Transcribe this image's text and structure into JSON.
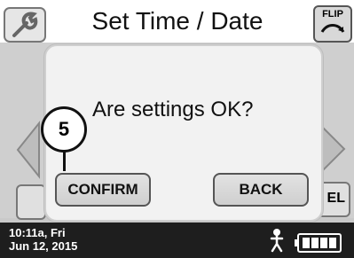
{
  "header": {
    "title": "Set Time / Date",
    "flip_label": "FLIP",
    "left_icon": "wrench-icon",
    "right_icon": "flip-icon"
  },
  "dialog": {
    "question": "Are settings OK?",
    "confirm_label": "CONFIRM",
    "back_label": "BACK",
    "callout_number": "5"
  },
  "background": {
    "partial_right_button_text": "EL"
  },
  "status": {
    "time_line1": "10:11a, Fri",
    "time_line2": "Jun 12, 2015",
    "person_icon": "person-icon",
    "battery_icon": "battery-icon",
    "battery_level_fraction": 1.0
  },
  "colors": {
    "statusbar": "#1e1e1e",
    "dialog_bg": "#f2f2f2",
    "button_bg": "#d6d6d6"
  }
}
